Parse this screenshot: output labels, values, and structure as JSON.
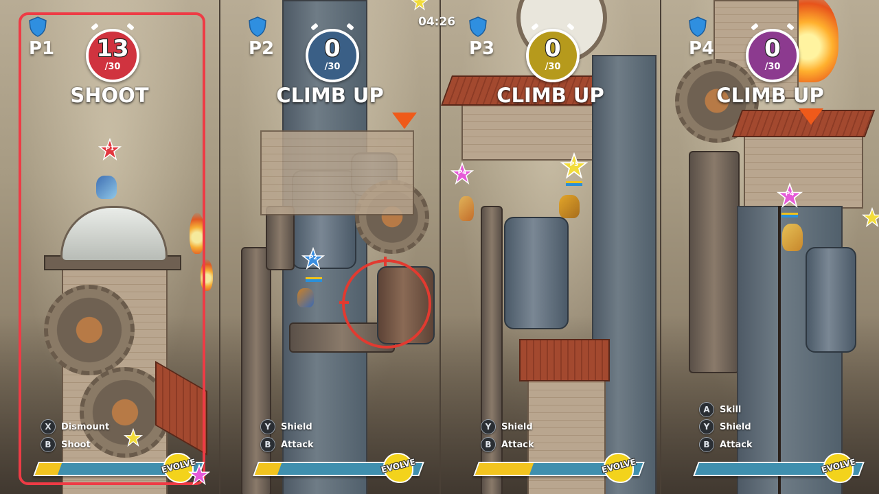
{
  "timer": "04:26",
  "colors": {
    "p1": "#d0333f",
    "p2": "#3a5f86",
    "p3": "#b69a1c",
    "p4": "#8c3a8f",
    "selected_frame": "#ee3b45",
    "evolve_fill": "#f2c41f",
    "evolve_bar": "#3f8fae"
  },
  "players": [
    {
      "label": "P1",
      "count": "13",
      "total": "/30",
      "action": "SHOOT",
      "controls": [
        {
          "button": "X",
          "label": "Dismount"
        },
        {
          "button": "B",
          "label": "Shoot"
        }
      ],
      "evolve_label": "EVOLVE",
      "evolve_progress": 0.14,
      "selected": true,
      "icons": [
        "shield-icon",
        "p1-star-marker"
      ]
    },
    {
      "label": "P2",
      "count": "0",
      "total": "/30",
      "action": "CLIMB UP",
      "controls": [
        {
          "button": "Y",
          "label": "Shield"
        },
        {
          "button": "B",
          "label": "Attack"
        }
      ],
      "evolve_label": "EVOLVE",
      "evolve_progress": 0.14,
      "selected": false,
      "icons": [
        "shield-icon",
        "p2-star-marker",
        "target-reticle"
      ]
    },
    {
      "label": "P3",
      "count": "0",
      "total": "/30",
      "action": "CLIMB UP",
      "controls": [
        {
          "button": "Y",
          "label": "Shield"
        },
        {
          "button": "B",
          "label": "Attack"
        }
      ],
      "evolve_label": "EVOLVE",
      "evolve_progress": 0.33,
      "selected": false,
      "icons": [
        "shield-icon",
        "p3-star-marker"
      ]
    },
    {
      "label": "P4",
      "count": "0",
      "total": "/30",
      "action": "CLIMB UP",
      "controls": [
        {
          "button": "A",
          "label": "Skill"
        },
        {
          "button": "Y",
          "label": "Shield"
        },
        {
          "button": "B",
          "label": "Attack"
        }
      ],
      "evolve_label": "EVOLVE",
      "evolve_progress": 0.0,
      "selected": false,
      "icons": [
        "shield-icon",
        "p4-star-marker"
      ]
    }
  ],
  "world_markers": {
    "p1": "P1",
    "p2": "P2",
    "p3": "P3",
    "p4": "P4"
  }
}
